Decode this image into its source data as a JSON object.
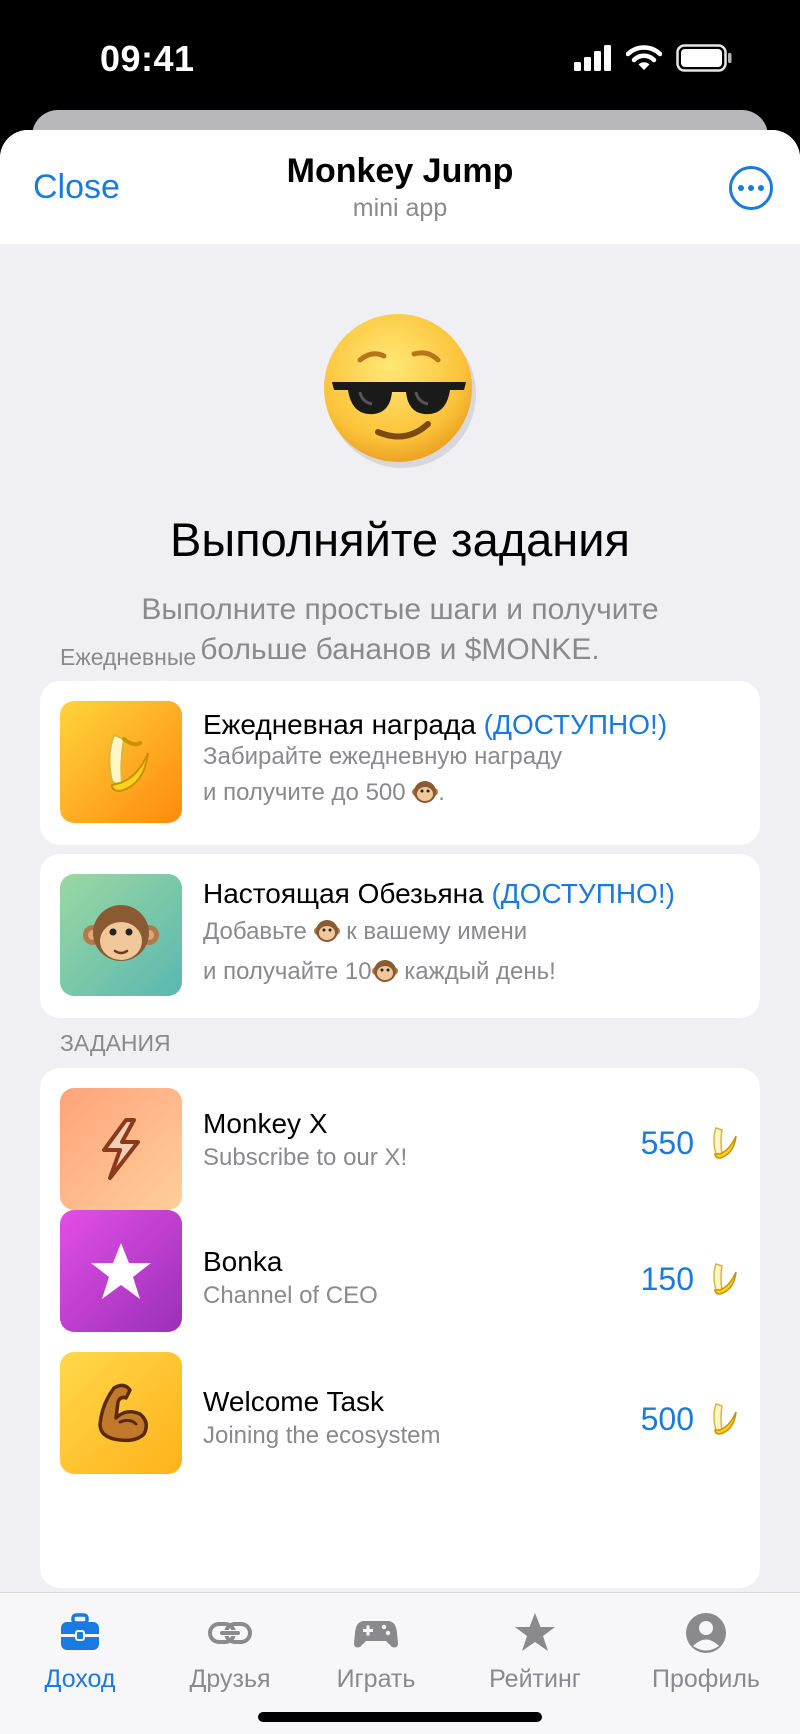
{
  "status_bar": {
    "time": "09:41"
  },
  "header": {
    "close_label": "Close",
    "title": "Monkey Jump",
    "subtitle": "mini app"
  },
  "hero": {
    "icon": "sunglasses-face-icon",
    "title": "Выполняйте задания",
    "subtitle": "Выполните простые шаги и получите больше бананов и $MONKE."
  },
  "daily": {
    "section_label": "Ежедневные",
    "items": [
      {
        "icon": "banana-icon",
        "title": "Ежедневная награда",
        "status": "(ДОСТУПНО!)",
        "desc_line1": "Забирайте ежедневную награду",
        "desc_line2_pre": "и получите до 500",
        "desc_line2_post": "."
      },
      {
        "icon": "monkey-face-icon",
        "title": "Настоящая Обезьяна",
        "status": "(ДОСТУПНО!)",
        "desc_line1_pre": "Добавьте",
        "desc_line1_post": "к вашему имени",
        "desc_line2_pre": "и получайте 10",
        "desc_line2_post": "каждый день!"
      }
    ]
  },
  "tasks": {
    "section_label": "ЗАДАНИЯ",
    "items": [
      {
        "icon": "bolt-icon",
        "title": "Monkey X",
        "desc": "Subscribe to our X!",
        "reward": "550"
      },
      {
        "icon": "star-icon",
        "title": "Bonka",
        "desc": "Channel of CEO",
        "reward": "150"
      },
      {
        "icon": "flexed-arm-icon",
        "title": "Welcome Task",
        "desc": "Joining the ecosystem",
        "reward": "500"
      }
    ]
  },
  "tabbar": {
    "tabs": [
      {
        "icon": "briefcase-icon",
        "label": "Доход",
        "active": true
      },
      {
        "icon": "link-icon",
        "label": "Друзья",
        "active": false
      },
      {
        "icon": "gamepad-icon",
        "label": "Играть",
        "active": false
      },
      {
        "icon": "star-icon",
        "label": "Рейтинг",
        "active": false
      },
      {
        "icon": "profile-icon",
        "label": "Профиль",
        "active": false
      }
    ]
  },
  "colors": {
    "accent": "#1a7ae0",
    "background": "#efeff4",
    "secondary_text": "#8a8a8e"
  }
}
